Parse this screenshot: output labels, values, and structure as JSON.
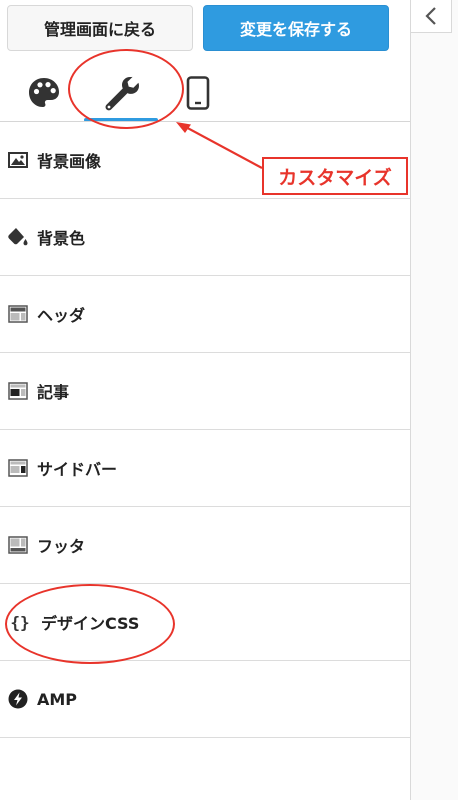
{
  "toolbar": {
    "back_label": "管理画面に戻る",
    "save_label": "変更を保存する"
  },
  "tabs": [
    {
      "name": "palette-icon"
    },
    {
      "name": "wrench-icon",
      "active": true
    },
    {
      "name": "mobile-icon"
    }
  ],
  "annotation": {
    "callout_label": "カスタマイズ"
  },
  "menu": {
    "items": [
      {
        "label": "背景画像",
        "icon": "image-icon"
      },
      {
        "label": "背景色",
        "icon": "paint-bucket-icon"
      },
      {
        "label": "ヘッダ",
        "icon": "layout-header-icon"
      },
      {
        "label": "記事",
        "icon": "layout-article-icon"
      },
      {
        "label": "サイドバー",
        "icon": "layout-sidebar-icon"
      },
      {
        "label": "フッタ",
        "icon": "layout-footer-icon"
      },
      {
        "label": "デザインCSS",
        "icon": "braces-icon"
      },
      {
        "label": "AMP",
        "icon": "amp-bolt-icon"
      }
    ]
  },
  "colors": {
    "accent": "#2f9be0",
    "annotation": "#e8342b"
  }
}
